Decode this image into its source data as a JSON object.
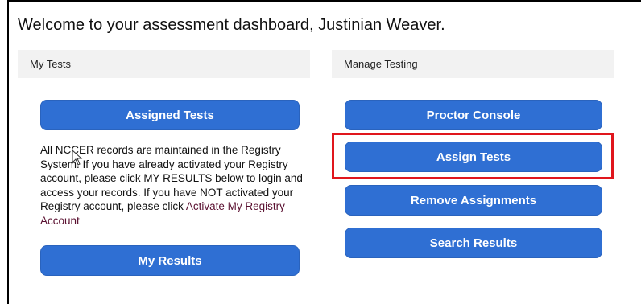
{
  "welcome": "Welcome to your assessment dashboard, Justinian Weaver.",
  "left_panel": {
    "header": "My Tests",
    "assigned_button": "Assigned Tests",
    "info_text": "All NCCER records are maintained in the Registry System. If you have already activated your Registry account, please click MY RESULTS below to login and access your records. If you have NOT activated your Registry account, please click",
    "activate_link": "Activate My Registry Account",
    "results_button": "My Results"
  },
  "right_panel": {
    "header": "Manage Testing",
    "buttons": [
      "Proctor Console",
      "Assign Tests",
      "Remove Assignments",
      "Search Results"
    ]
  },
  "colors": {
    "button_blue": "#2f6fd3",
    "highlight_red": "#e0161d",
    "link": "#5a1030"
  },
  "icons": [
    "mouse-pointer-icon"
  ]
}
